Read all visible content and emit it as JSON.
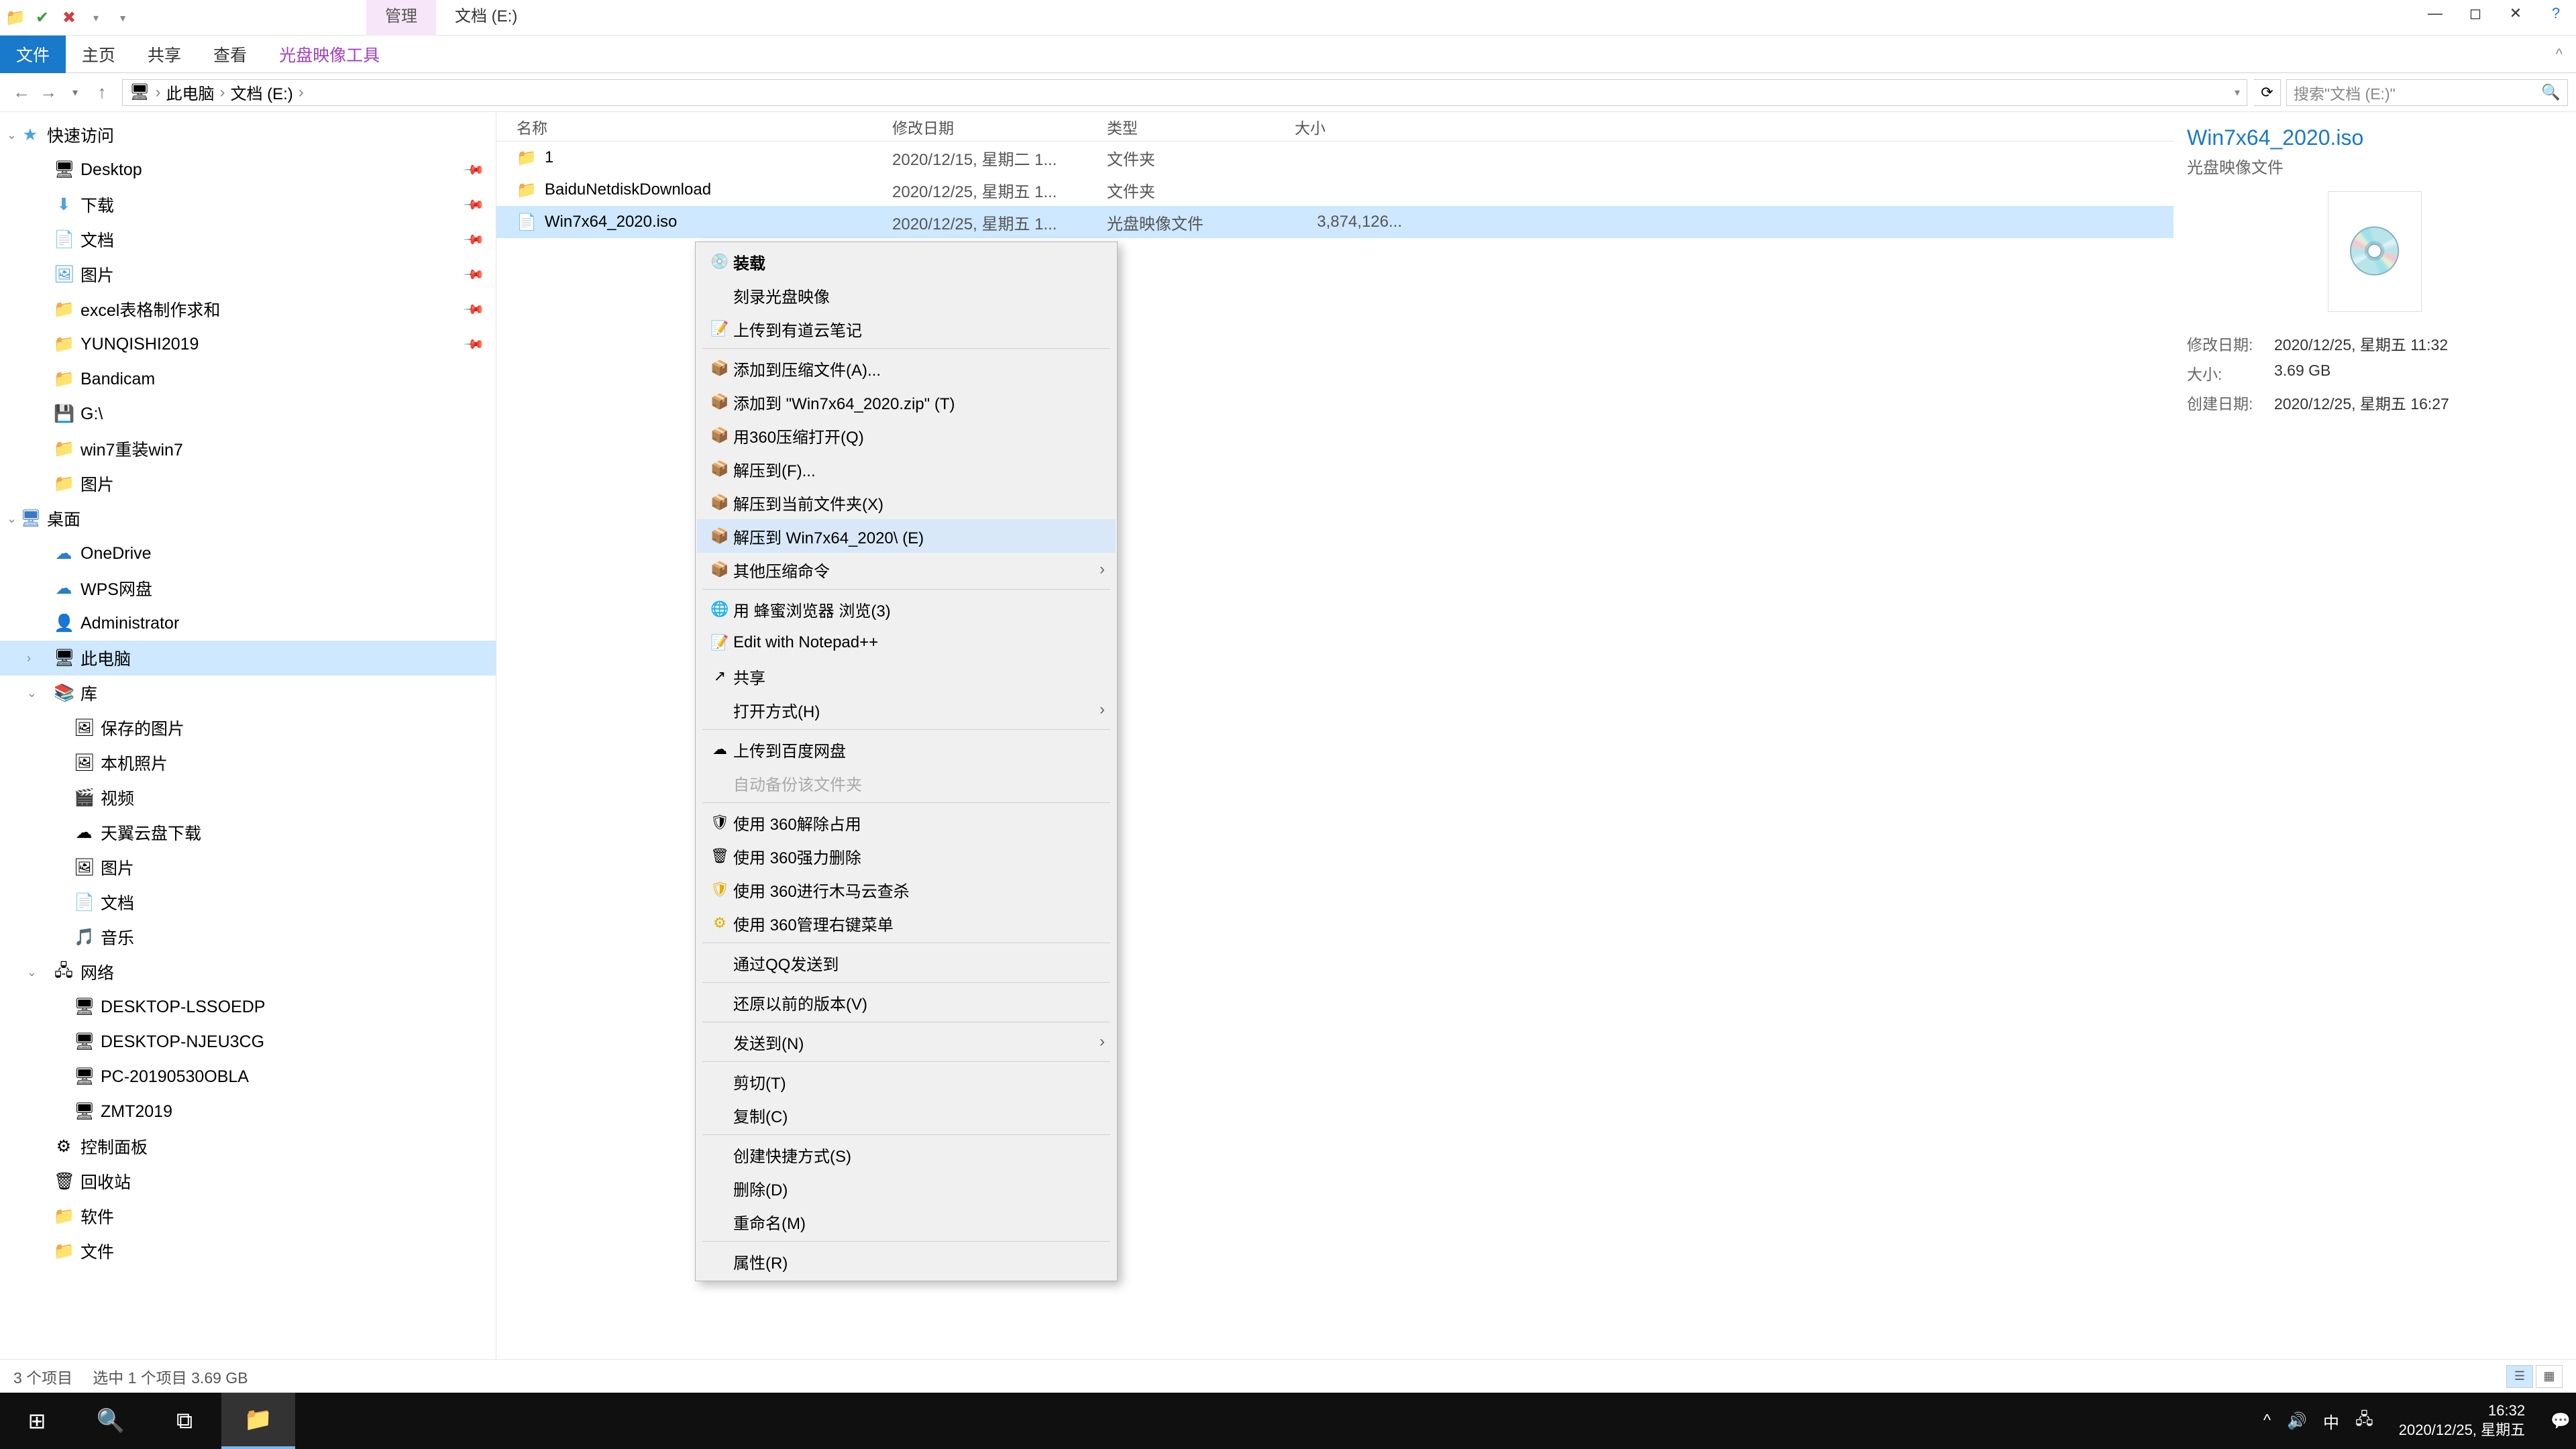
{
  "title": "文档 (E:)",
  "contextTab": "管理",
  "ribbon": {
    "file": "文件",
    "home": "主页",
    "share": "共享",
    "view": "查看",
    "tools": "光盘映像工具"
  },
  "nav": {
    "back": "←",
    "fwd": "→",
    "up": "↑"
  },
  "breadcrumb": [
    "此电脑",
    "文档 (E:)"
  ],
  "searchPlaceholder": "搜索\"文档 (E:)\"",
  "tree": [
    {
      "l": 1,
      "label": "快速访问",
      "icon": "★",
      "color": "#4aa3e0",
      "chev": "v"
    },
    {
      "l": 2,
      "label": "Desktop",
      "icon": "🖥",
      "pin": true
    },
    {
      "l": 2,
      "label": "下载",
      "icon": "⬇",
      "pin": true,
      "color": "#4aa3e0"
    },
    {
      "l": 2,
      "label": "文档",
      "icon": "📄",
      "pin": true,
      "color": "#4aa3e0"
    },
    {
      "l": 2,
      "label": "图片",
      "icon": "🖼",
      "pin": true,
      "color": "#4aa3e0"
    },
    {
      "l": 2,
      "label": "excel表格制作求和",
      "icon": "📁",
      "pin": true
    },
    {
      "l": 2,
      "label": "YUNQISHI2019",
      "icon": "📁",
      "pin": true
    },
    {
      "l": 2,
      "label": "Bandicam",
      "icon": "📁"
    },
    {
      "l": 2,
      "label": "G:\\",
      "icon": "💾"
    },
    {
      "l": 2,
      "label": "win7重装win7",
      "icon": "📁"
    },
    {
      "l": 2,
      "label": "图片",
      "icon": "📁"
    },
    {
      "l": 1,
      "label": "桌面",
      "icon": "🖥",
      "color": "#3b78c4",
      "chev": "v"
    },
    {
      "l": 2,
      "label": "OneDrive",
      "icon": "☁",
      "color": "#2a7ec7"
    },
    {
      "l": 2,
      "label": "WPS网盘",
      "icon": "☁",
      "color": "#2a7ec7"
    },
    {
      "l": 2,
      "label": "Administrator",
      "icon": "👤"
    },
    {
      "l": 2,
      "label": "此电脑",
      "icon": "🖥",
      "sel": true,
      "chev": ">"
    },
    {
      "l": 2,
      "label": "库",
      "icon": "📚",
      "chev": "v"
    },
    {
      "l": 3,
      "label": "保存的图片",
      "icon": "🖼"
    },
    {
      "l": 3,
      "label": "本机照片",
      "icon": "🖼"
    },
    {
      "l": 3,
      "label": "视频",
      "icon": "🎬"
    },
    {
      "l": 3,
      "label": "天翼云盘下载",
      "icon": "☁"
    },
    {
      "l": 3,
      "label": "图片",
      "icon": "🖼"
    },
    {
      "l": 3,
      "label": "文档",
      "icon": "📄"
    },
    {
      "l": 3,
      "label": "音乐",
      "icon": "🎵"
    },
    {
      "l": 2,
      "label": "网络",
      "icon": "🖧",
      "chev": "v"
    },
    {
      "l": 3,
      "label": "DESKTOP-LSSOEDP",
      "icon": "🖥"
    },
    {
      "l": 3,
      "label": "DESKTOP-NJEU3CG",
      "icon": "🖥"
    },
    {
      "l": 3,
      "label": "PC-20190530OBLA",
      "icon": "🖥"
    },
    {
      "l": 3,
      "label": "ZMT2019",
      "icon": "🖥"
    },
    {
      "l": 2,
      "label": "控制面板",
      "icon": "⚙"
    },
    {
      "l": 2,
      "label": "回收站",
      "icon": "🗑"
    },
    {
      "l": 2,
      "label": "软件",
      "icon": "📁"
    },
    {
      "l": 2,
      "label": "文件",
      "icon": "📁"
    }
  ],
  "columns": {
    "name": "名称",
    "date": "修改日期",
    "type": "类型",
    "size": "大小"
  },
  "files": [
    {
      "name": "1",
      "date": "2020/12/15, 星期二 1...",
      "type": "文件夹",
      "size": "",
      "kind": "folder"
    },
    {
      "name": "BaiduNetdiskDownload",
      "date": "2020/12/25, 星期五 1...",
      "type": "文件夹",
      "size": "",
      "kind": "folder"
    },
    {
      "name": "Win7x64_2020.iso",
      "date": "2020/12/25, 星期五 1...",
      "type": "光盘映像文件",
      "size": "3,874,126...",
      "kind": "file",
      "sel": true
    }
  ],
  "contextMenu": [
    {
      "icon": "💿",
      "label": "装载",
      "bold": true
    },
    {
      "icon": "",
      "label": "刻录光盘映像"
    },
    {
      "icon": "📝",
      "color": "#2a7ec7",
      "label": "上传到有道云笔记"
    },
    {
      "sep": true
    },
    {
      "icon": "📦",
      "label": "添加到压缩文件(A)..."
    },
    {
      "icon": "📦",
      "label": "添加到 \"Win7x64_2020.zip\" (T)"
    },
    {
      "icon": "📦",
      "label": "用360压缩打开(Q)"
    },
    {
      "icon": "📦",
      "label": "解压到(F)..."
    },
    {
      "icon": "📦",
      "label": "解压到当前文件夹(X)"
    },
    {
      "icon": "📦",
      "label": "解压到 Win7x64_2020\\ (E)",
      "hover": true
    },
    {
      "icon": "📦",
      "label": "其他压缩命令",
      "arrow": true
    },
    {
      "sep": true
    },
    {
      "icon": "🌐",
      "label": "用 蜂蜜浏览器 浏览(3)"
    },
    {
      "icon": "📝",
      "label": "Edit with Notepad++"
    },
    {
      "icon": "↗",
      "label": "共享"
    },
    {
      "icon": "",
      "label": "打开方式(H)",
      "arrow": true
    },
    {
      "sep": true
    },
    {
      "icon": "☁",
      "label": "上传到百度网盘"
    },
    {
      "icon": "",
      "label": "自动备份该文件夹",
      "disabled": true
    },
    {
      "sep": true
    },
    {
      "icon": "🛡",
      "label": "使用 360解除占用"
    },
    {
      "icon": "🗑",
      "label": "使用 360强力删除"
    },
    {
      "icon": "🛡",
      "color": "#e0b000",
      "label": "使用 360进行木马云查杀"
    },
    {
      "icon": "⚙",
      "color": "#e0b000",
      "label": "使用 360管理右键菜单"
    },
    {
      "sep": true
    },
    {
      "icon": "",
      "label": "通过QQ发送到"
    },
    {
      "sep": true
    },
    {
      "icon": "",
      "label": "还原以前的版本(V)"
    },
    {
      "sep": true
    },
    {
      "icon": "",
      "label": "发送到(N)",
      "arrow": true
    },
    {
      "sep": true
    },
    {
      "icon": "",
      "label": "剪切(T)"
    },
    {
      "icon": "",
      "label": "复制(C)"
    },
    {
      "sep": true
    },
    {
      "icon": "",
      "label": "创建快捷方式(S)"
    },
    {
      "icon": "",
      "label": "删除(D)"
    },
    {
      "icon": "",
      "label": "重命名(M)"
    },
    {
      "sep": true
    },
    {
      "icon": "",
      "label": "属性(R)"
    }
  ],
  "details": {
    "title": "Win7x64_2020.iso",
    "subtitle": "光盘映像文件",
    "rows": [
      {
        "label": "修改日期:",
        "val": "2020/12/25, 星期五 11:32"
      },
      {
        "label": "大小:",
        "val": "3.69 GB"
      },
      {
        "label": "创建日期:",
        "val": "2020/12/25, 星期五 16:27"
      }
    ]
  },
  "status": {
    "count": "3 个项目",
    "sel": "选中 1 个项目  3.69 GB"
  },
  "taskbar": {
    "time": "16:32",
    "date": "2020/12/25, 星期五",
    "ime": "中"
  }
}
